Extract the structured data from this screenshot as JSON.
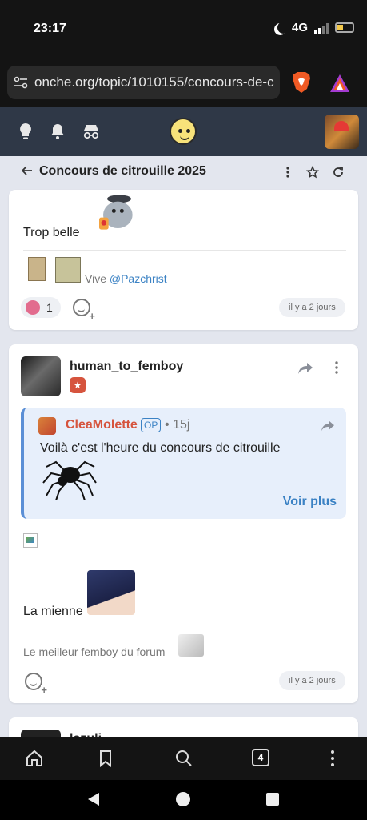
{
  "status_bar": {
    "time": "23:17",
    "network": "4G"
  },
  "browser": {
    "url": "onche.org/topic/1010155/concours-de-c"
  },
  "topic": {
    "title": "Concours de citrouille 2025"
  },
  "post1": {
    "text": "Trop belle",
    "signature_prefix": "Vive ",
    "signature_mention": "@Pazchrist",
    "reaction_count": "1",
    "time": "il y a 2 jours"
  },
  "post2": {
    "username": "human_to_femboy",
    "quote": {
      "author": "CleaMolette",
      "op_label": "OP",
      "time": "• 15j",
      "text": "Voilà c'est l'heure du concours de citrouille",
      "more": "Voir plus"
    },
    "text": "La mienne",
    "signature": "Le meilleur femboy du forum",
    "time": "il y a 2 jours"
  },
  "post3": {
    "username": "lazuli"
  },
  "bottom_nav": {
    "tab_count": "4"
  },
  "colors": {
    "accent": "#3b82c4",
    "header": "#2f3847",
    "op_name": "#d6543e"
  }
}
